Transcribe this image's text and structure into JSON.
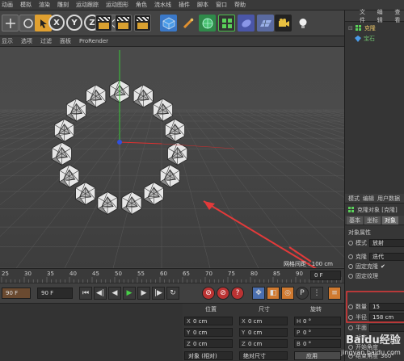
{
  "menu": [
    "动画",
    "模拟",
    "渲染",
    "雕刻",
    "运动跟踪",
    "运动图形",
    "角色",
    "流水线",
    "插件",
    "脚本",
    "窗口",
    "帮助"
  ],
  "toolbar": {
    "x_label": "X",
    "y_label": "Y",
    "z_label": "Z"
  },
  "object_manager": {
    "tabs": [
      "文件",
      "编辑",
      "查看"
    ],
    "items": [
      {
        "label": "克隆",
        "color": "#e8c468"
      },
      {
        "label": "宝石",
        "color": "#6fbf6f"
      }
    ]
  },
  "viewport": {
    "menu": [
      "显示",
      "选项",
      "过滤",
      "面板",
      "ProRender"
    ],
    "status": "网格间距 : 100 cm"
  },
  "attributes": {
    "header_tabs": [
      "模式",
      "编辑",
      "用户数据"
    ],
    "object_title": "克隆对象 [克隆]",
    "sub_tabs": [
      "基本",
      "坐标",
      "对象"
    ],
    "section": "对象属性",
    "mode_label": "模式",
    "mode_value": "放射",
    "clone_label": "克隆",
    "clone_value": "迭代",
    "fixed_clone_label": "固定克隆",
    "fixed_texture_label": "固定纹理",
    "count_label": "数量",
    "count_value": "15",
    "radius_label": "半径",
    "radius_value": "158 cm",
    "plane_label": "平面",
    "align_label": "对齐",
    "start_angle_label": "开始角度",
    "end_angle_label": "结束角度",
    "end_angle_value": "360°"
  },
  "timeline": {
    "ticks": [
      "25",
      "30",
      "35",
      "40",
      "45",
      "50",
      "55",
      "60",
      "65",
      "70",
      "75",
      "80",
      "85",
      "90"
    ],
    "current_frame": "0 F",
    "start_frame": "90 F",
    "end_frame": "90 F"
  },
  "coordinates": {
    "headers": [
      "位置",
      "尺寸",
      "旋转"
    ],
    "rows": [
      {
        "axis_pos": "X",
        "pos": "0 cm",
        "axis_size": "X",
        "size": "0 cm",
        "axis_rot": "H",
        "rot": "0 °"
      },
      {
        "axis_pos": "Y",
        "pos": "0 cm",
        "axis_size": "Y",
        "size": "0 cm",
        "axis_rot": "P",
        "rot": "0 °"
      },
      {
        "axis_pos": "Z",
        "pos": "0 cm",
        "axis_size": "Z",
        "size": "0 cm",
        "axis_rot": "B",
        "rot": "0 °"
      }
    ],
    "mode_button": "对象 (相对)",
    "size_button": "绝对尺寸",
    "apply_button": "应用"
  },
  "watermark": {
    "brand": "Baidu经验",
    "url": "jingyan.baidu.com"
  },
  "colors": {
    "accent_orange": "#e8a030",
    "annotation_red": "#e23a3a",
    "axis_green": "#38c838",
    "axis_blue": "#3050e0",
    "axis_red": "#e03030"
  }
}
